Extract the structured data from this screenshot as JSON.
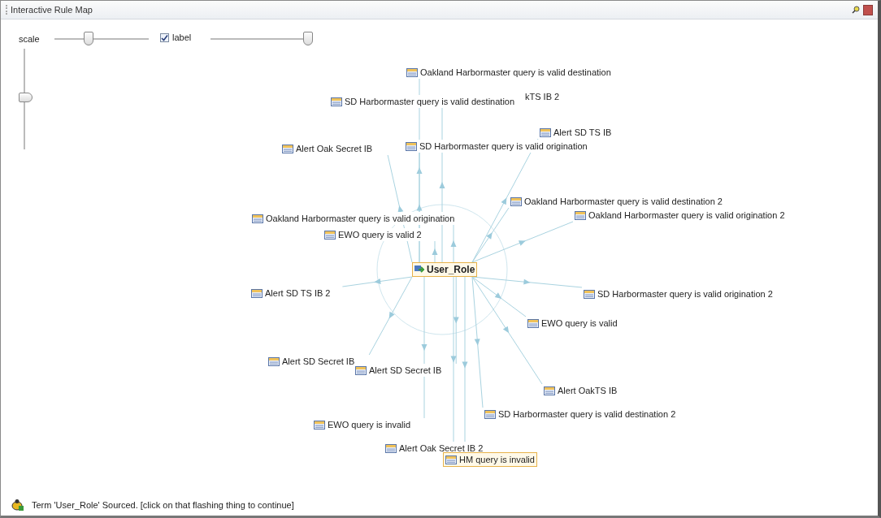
{
  "window": {
    "title": "Interactive Rule Map"
  },
  "controls": {
    "scale_label": "scale",
    "scale_slider": {
      "level": 0.36
    },
    "zoom_slider": {
      "level": 0.52
    },
    "label_checkbox": {
      "label": "label",
      "checked": true
    },
    "label_slider": {
      "level": 0.97
    }
  },
  "center_node": {
    "label": "User_Role",
    "selected": true
  },
  "nodes": [
    {
      "label": "Oakland Harbormaster query is valid destination",
      "kind": "rule",
      "selected": false
    },
    {
      "label": "kTS IB 2",
      "kind": "partial",
      "selected": false
    },
    {
      "label": "SD Harbormaster query is valid destination",
      "kind": "rule",
      "selected": false
    },
    {
      "label": "Alert SD TS IB",
      "kind": "rule",
      "selected": false
    },
    {
      "label": "Alert Oak Secret IB",
      "kind": "rule",
      "selected": false
    },
    {
      "label": "SD Harbormaster query is valid origination",
      "kind": "rule",
      "selected": false
    },
    {
      "label": "Oakland Harbormaster query is valid destination 2",
      "kind": "rule",
      "selected": false
    },
    {
      "label": "Oakland Harbormaster query is valid origination 2",
      "kind": "rule",
      "selected": false
    },
    {
      "label": "Oakland Harbormaster query is valid origination",
      "kind": "rule",
      "selected": false
    },
    {
      "label": "EWO query is valid 2",
      "kind": "rule",
      "selected": false
    },
    {
      "label": "Alert SD TS IB 2",
      "kind": "rule",
      "selected": false
    },
    {
      "label": "SD Harbormaster query is valid origination 2",
      "kind": "rule",
      "selected": false
    },
    {
      "label": "EWO query is valid",
      "kind": "rule",
      "selected": false
    },
    {
      "label": "Alert SD Secret IB",
      "kind": "rule",
      "selected": false
    },
    {
      "label": "Alert SD Secret IB",
      "kind": "rule",
      "selected": false
    },
    {
      "label": "Alert OakTS IB",
      "kind": "rule",
      "selected": false
    },
    {
      "label": "SD Harbormaster query is valid destination 2",
      "kind": "rule",
      "selected": false
    },
    {
      "label": "EWO query is invalid",
      "kind": "rule",
      "selected": false
    },
    {
      "label": "Alert Oak Secret IB 2",
      "kind": "rule",
      "selected": false
    },
    {
      "label": "HM query is invalid",
      "kind": "rule",
      "selected": true
    }
  ],
  "status_bar": {
    "message": "Term 'User_Role' Sourced. [click on that flashing thing to continue]"
  }
}
